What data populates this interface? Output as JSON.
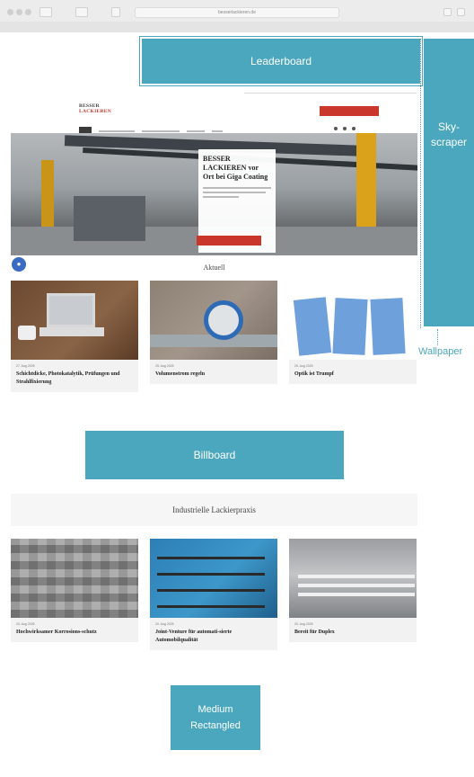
{
  "browser": {
    "url": "besserlackieren.de"
  },
  "ads": {
    "leaderboard": "Leaderboard",
    "skyscraper_line1": "Sky-",
    "skyscraper_line2": "scraper",
    "wallpaper": "Wallpaper",
    "billboard": "Billboard",
    "medium_rect_line1": "Medium",
    "medium_rect_line2": "Rectangled"
  },
  "site": {
    "logo_line1": "BESSER",
    "logo_line2": "LACKIEREN",
    "hero": {
      "title": "BESSER LACKIEREN vor Ort bei Giga Coating"
    },
    "section_news": "Aktuell",
    "section_practice": "Industrielle Lackierpraxis",
    "articles_top": [
      {
        "meta": "27. Aug 2025",
        "title": "Schichtdicke, Photokatalytik, Prüfungen und Strahlfixierung"
      },
      {
        "meta": "25. Aug 2025",
        "title": "Volumenstrom regeln"
      },
      {
        "meta": "25. Aug 2025",
        "title": "Optik ist Trumpf"
      }
    ],
    "articles_bottom": [
      {
        "meta": "20. Aug 2025",
        "title": "Hochwirksamer Korrosions-schutz"
      },
      {
        "meta": "20. Aug 2025",
        "title": "Joint-Venture für automati-sierte Automobilqualität"
      },
      {
        "meta": "20. Aug 2025",
        "title": "Bereit für Duplex"
      }
    ]
  },
  "colors": {
    "ad_blue": "#4ba7bd",
    "brand_red": "#c8362c"
  }
}
